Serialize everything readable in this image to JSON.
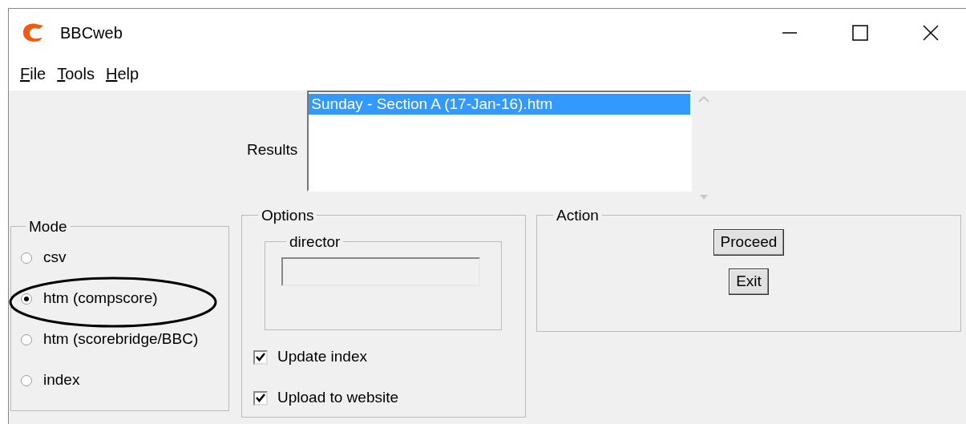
{
  "window": {
    "title": "BBCweb"
  },
  "menu": [
    "File",
    "Tools",
    "Help"
  ],
  "results": {
    "label": "Results",
    "items": [
      {
        "text": "Sunday - Section A (17-Jan-16).htm",
        "selected": true
      }
    ]
  },
  "mode": {
    "title": "Mode",
    "options": [
      {
        "label": "csv",
        "selected": false
      },
      {
        "label": "htm (compscore)",
        "selected": true
      },
      {
        "label": "htm (scorebridge/BBC)",
        "selected": false
      },
      {
        "label": "index",
        "selected": false
      }
    ]
  },
  "options": {
    "title": "Options",
    "director": {
      "title": "director",
      "disabled": true
    },
    "checkboxes": [
      {
        "label": "Update index",
        "checked": true
      },
      {
        "label": "Upload to website",
        "checked": true
      }
    ]
  },
  "action": {
    "title": "Action",
    "buttons": [
      "Proceed",
      "Exit"
    ]
  }
}
